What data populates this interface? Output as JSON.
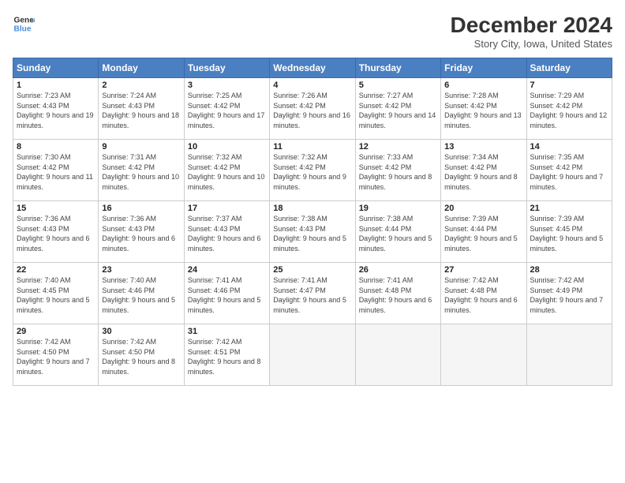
{
  "header": {
    "logo_line1": "General",
    "logo_line2": "Blue",
    "title": "December 2024",
    "location": "Story City, Iowa, United States"
  },
  "days_of_week": [
    "Sunday",
    "Monday",
    "Tuesday",
    "Wednesday",
    "Thursday",
    "Friday",
    "Saturday"
  ],
  "weeks": [
    [
      {
        "day": "1",
        "sunrise": "7:23 AM",
        "sunset": "4:43 PM",
        "daylight": "9 hours and 19 minutes."
      },
      {
        "day": "2",
        "sunrise": "7:24 AM",
        "sunset": "4:43 PM",
        "daylight": "9 hours and 18 minutes."
      },
      {
        "day": "3",
        "sunrise": "7:25 AM",
        "sunset": "4:42 PM",
        "daylight": "9 hours and 17 minutes."
      },
      {
        "day": "4",
        "sunrise": "7:26 AM",
        "sunset": "4:42 PM",
        "daylight": "9 hours and 16 minutes."
      },
      {
        "day": "5",
        "sunrise": "7:27 AM",
        "sunset": "4:42 PM",
        "daylight": "9 hours and 14 minutes."
      },
      {
        "day": "6",
        "sunrise": "7:28 AM",
        "sunset": "4:42 PM",
        "daylight": "9 hours and 13 minutes."
      },
      {
        "day": "7",
        "sunrise": "7:29 AM",
        "sunset": "4:42 PM",
        "daylight": "9 hours and 12 minutes."
      }
    ],
    [
      {
        "day": "8",
        "sunrise": "7:30 AM",
        "sunset": "4:42 PM",
        "daylight": "9 hours and 11 minutes."
      },
      {
        "day": "9",
        "sunrise": "7:31 AM",
        "sunset": "4:42 PM",
        "daylight": "9 hours and 10 minutes."
      },
      {
        "day": "10",
        "sunrise": "7:32 AM",
        "sunset": "4:42 PM",
        "daylight": "9 hours and 10 minutes."
      },
      {
        "day": "11",
        "sunrise": "7:32 AM",
        "sunset": "4:42 PM",
        "daylight": "9 hours and 9 minutes."
      },
      {
        "day": "12",
        "sunrise": "7:33 AM",
        "sunset": "4:42 PM",
        "daylight": "9 hours and 8 minutes."
      },
      {
        "day": "13",
        "sunrise": "7:34 AM",
        "sunset": "4:42 PM",
        "daylight": "9 hours and 8 minutes."
      },
      {
        "day": "14",
        "sunrise": "7:35 AM",
        "sunset": "4:42 PM",
        "daylight": "9 hours and 7 minutes."
      }
    ],
    [
      {
        "day": "15",
        "sunrise": "7:36 AM",
        "sunset": "4:43 PM",
        "daylight": "9 hours and 6 minutes."
      },
      {
        "day": "16",
        "sunrise": "7:36 AM",
        "sunset": "4:43 PM",
        "daylight": "9 hours and 6 minutes."
      },
      {
        "day": "17",
        "sunrise": "7:37 AM",
        "sunset": "4:43 PM",
        "daylight": "9 hours and 6 minutes."
      },
      {
        "day": "18",
        "sunrise": "7:38 AM",
        "sunset": "4:43 PM",
        "daylight": "9 hours and 5 minutes."
      },
      {
        "day": "19",
        "sunrise": "7:38 AM",
        "sunset": "4:44 PM",
        "daylight": "9 hours and 5 minutes."
      },
      {
        "day": "20",
        "sunrise": "7:39 AM",
        "sunset": "4:44 PM",
        "daylight": "9 hours and 5 minutes."
      },
      {
        "day": "21",
        "sunrise": "7:39 AM",
        "sunset": "4:45 PM",
        "daylight": "9 hours and 5 minutes."
      }
    ],
    [
      {
        "day": "22",
        "sunrise": "7:40 AM",
        "sunset": "4:45 PM",
        "daylight": "9 hours and 5 minutes."
      },
      {
        "day": "23",
        "sunrise": "7:40 AM",
        "sunset": "4:46 PM",
        "daylight": "9 hours and 5 minutes."
      },
      {
        "day": "24",
        "sunrise": "7:41 AM",
        "sunset": "4:46 PM",
        "daylight": "9 hours and 5 minutes."
      },
      {
        "day": "25",
        "sunrise": "7:41 AM",
        "sunset": "4:47 PM",
        "daylight": "9 hours and 5 minutes."
      },
      {
        "day": "26",
        "sunrise": "7:41 AM",
        "sunset": "4:48 PM",
        "daylight": "9 hours and 6 minutes."
      },
      {
        "day": "27",
        "sunrise": "7:42 AM",
        "sunset": "4:48 PM",
        "daylight": "9 hours and 6 minutes."
      },
      {
        "day": "28",
        "sunrise": "7:42 AM",
        "sunset": "4:49 PM",
        "daylight": "9 hours and 7 minutes."
      }
    ],
    [
      {
        "day": "29",
        "sunrise": "7:42 AM",
        "sunset": "4:50 PM",
        "daylight": "9 hours and 7 minutes."
      },
      {
        "day": "30",
        "sunrise": "7:42 AM",
        "sunset": "4:50 PM",
        "daylight": "9 hours and 8 minutes."
      },
      {
        "day": "31",
        "sunrise": "7:42 AM",
        "sunset": "4:51 PM",
        "daylight": "9 hours and 8 minutes."
      },
      null,
      null,
      null,
      null
    ]
  ],
  "labels": {
    "sunrise": "Sunrise:",
    "sunset": "Sunset:",
    "daylight": "Daylight:"
  }
}
